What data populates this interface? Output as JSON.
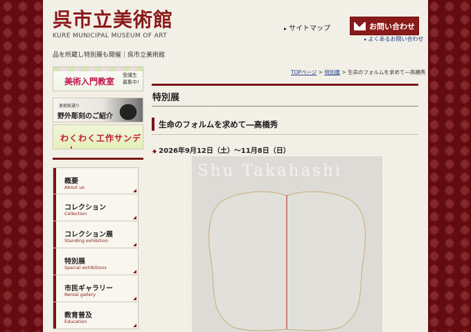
{
  "header": {
    "logo_jp": "呉市立美術館",
    "logo_en": "KURE MUNICIPAL MUSEUM OF ART",
    "tagline": "品を所蔵し特別展も開催｜呉市立美術館",
    "sitemap_label": "サイトマップ",
    "contact_label": "お問い合わせ",
    "faq_label": "よくあるお問い合わせ",
    "icons": {
      "sitemap_arrow": "arrow-right-icon",
      "mail": "mail-icon",
      "faq_arrow": "arrow-right-icon"
    }
  },
  "sidebar": {
    "banners": [
      {
        "title": "美術入門教室",
        "sub": "受講生 募集中！"
      },
      {
        "sub": "美術館通り",
        "title": "野外彫刻のご紹介"
      },
      {
        "title": "わくわく工作サンデー！"
      }
    ],
    "nav": [
      {
        "jp": "概要",
        "en": "About us"
      },
      {
        "jp": "コレクション",
        "en": "Collection"
      },
      {
        "jp": "コレクション展",
        "en": "Standing exhibition"
      },
      {
        "jp": "特別展",
        "en": "Special exhibitions"
      },
      {
        "jp": "市民ギャラリー",
        "en": "Rental gallery"
      },
      {
        "jp": "教育普及",
        "en": "Education"
      }
    ]
  },
  "main": {
    "breadcrumb": {
      "top": "TOPページ",
      "sep": " > ",
      "section": "特別展",
      "current": "生命のフォルムを求めて―高橋秀"
    },
    "section_title": "特別展",
    "exhibition_title": "生命のフォルムを求めて―高橋秀",
    "date": "2026年9月12日（土）〜11月8日（日）",
    "poster_artist": "Shu Takahashi"
  },
  "colors": {
    "brand": "#7a1417",
    "background_pattern": "#7a0d14",
    "link": "#1a3a8a",
    "page": "#f4f1e8"
  }
}
